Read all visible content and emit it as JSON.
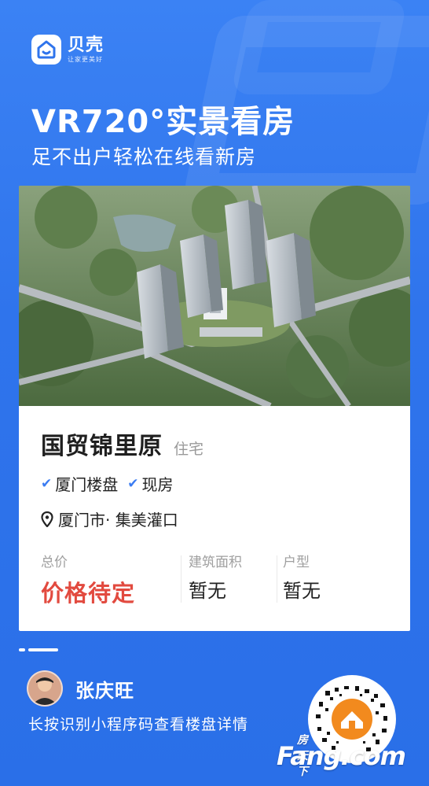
{
  "brand": {
    "name": "贝壳",
    "slogan": "让家更美好"
  },
  "headline": "VR720°实景看房",
  "subline": "足不出户轻松在线看新房",
  "project": {
    "name": "国贸锦里原",
    "type": "住宅",
    "tags": [
      "厦门楼盘",
      "现房"
    ],
    "location": "厦门市· 集美灌口"
  },
  "stats": {
    "price_label": "总价",
    "price_value": "价格待定",
    "area_label": "建筑面积",
    "area_value": "暂无",
    "layout_label": "户型",
    "layout_value": "暂无"
  },
  "agent": {
    "name": "张庆旺",
    "hint": "长按识别小程序码查看楼盘详情"
  },
  "watermark": {
    "cn": "房天下",
    "en": "Fang.com"
  },
  "colors": {
    "primary": "#3b82f4",
    "price": "#e24a3f",
    "check": "#3b7cf2"
  },
  "icons": [
    "shell-logo-icon",
    "check-icon",
    "location-pin-icon",
    "qr-code-icon"
  ]
}
